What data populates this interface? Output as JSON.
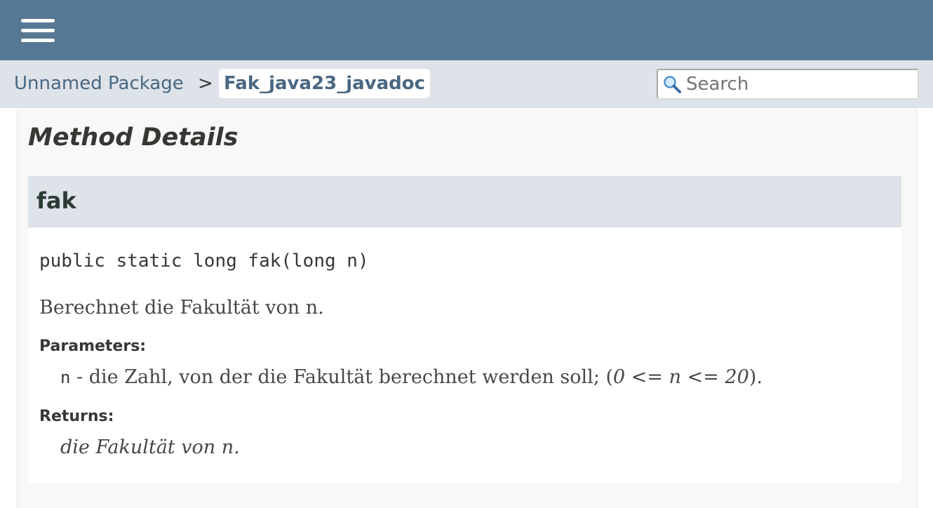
{
  "header": {
    "menu_icon": "hamburger-menu-icon"
  },
  "breadcrumb": {
    "package_label": "Unnamed Package",
    "separator": ">",
    "current_label": "Fak_java23_javadoc"
  },
  "search": {
    "icon": "magnifier-search-icon",
    "placeholder": "Search"
  },
  "details": {
    "section_title": "Method Details",
    "method": {
      "name": "fak",
      "signature": "public static long fak(long n)",
      "description": "Berechnet die Fakultät von n.",
      "parameters_label": "Parameters:",
      "param_name": "n",
      "param_text": " - die Zahl, von der die Fakultät berechnet werden soll; (",
      "param_range": "0 <= n <= 20",
      "param_end": ").",
      "returns_label": "Returns:",
      "returns_text": "die Fakultät von n."
    }
  }
}
